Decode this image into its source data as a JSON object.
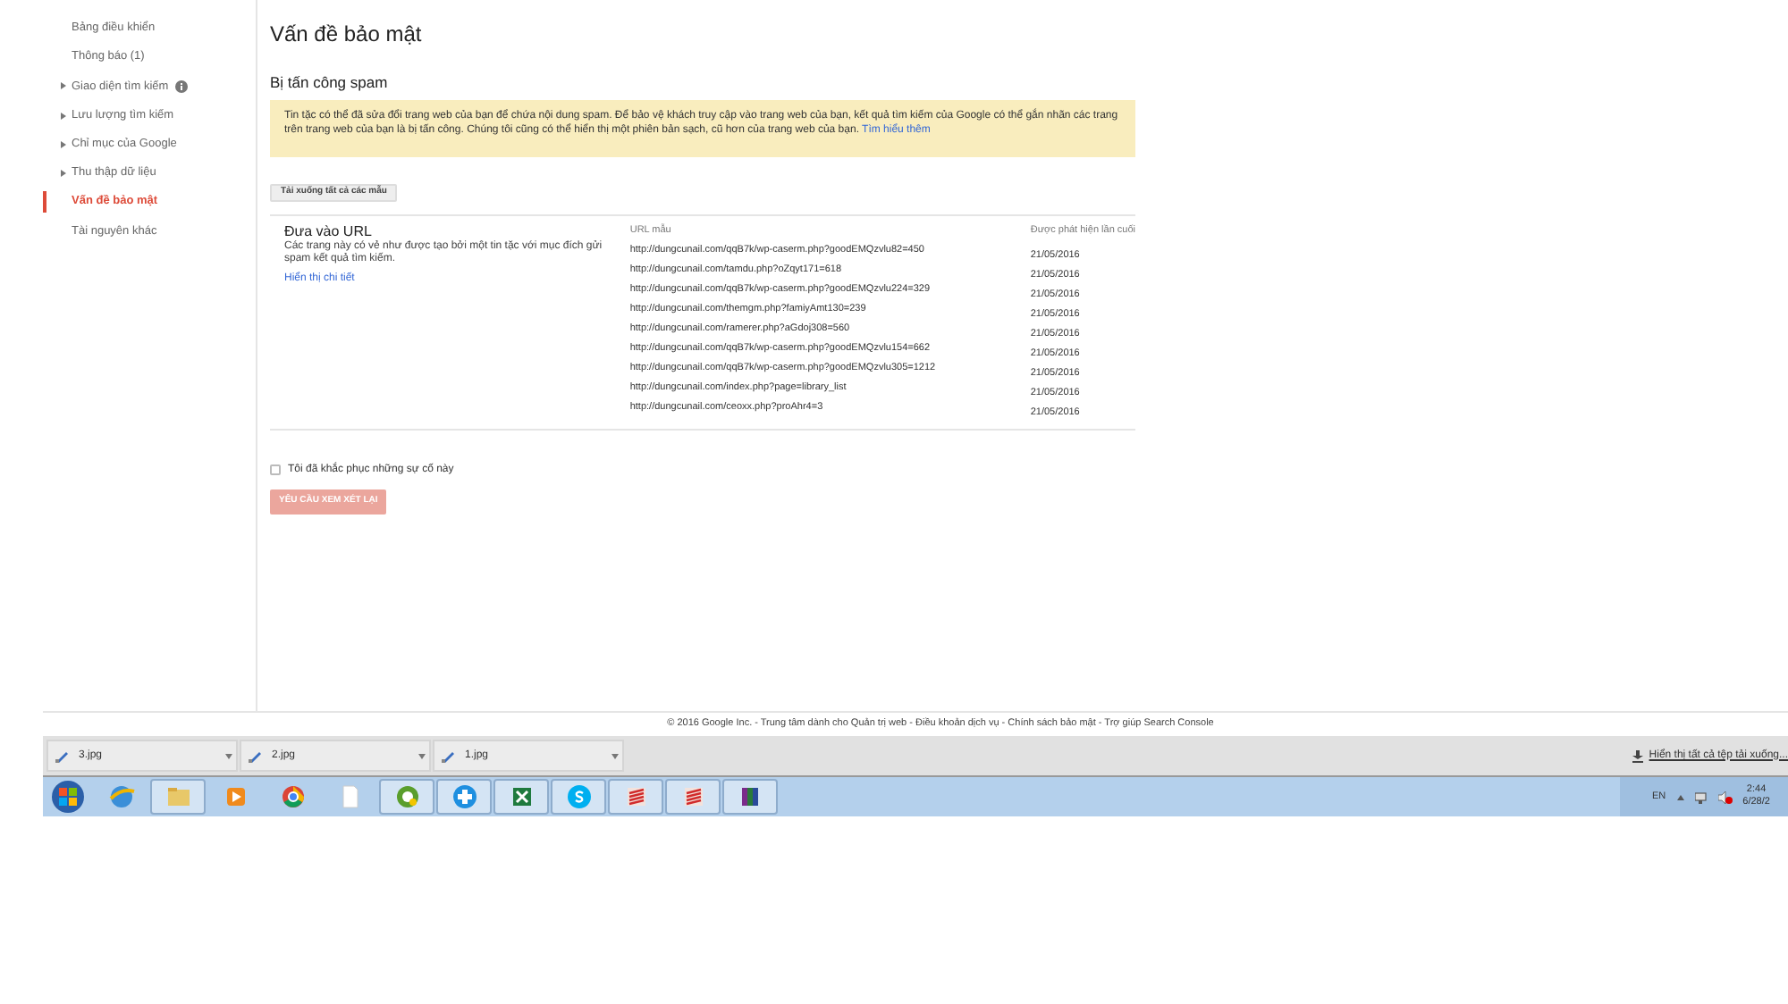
{
  "sidebar": {
    "items": [
      {
        "label": "Bảng điều khiển",
        "expandable": false,
        "selected": false,
        "info": false
      },
      {
        "label": "Thông báo (1)",
        "expandable": false,
        "selected": false,
        "info": false
      },
      {
        "label": "Giao diện tìm kiếm",
        "expandable": true,
        "selected": false,
        "info": true
      },
      {
        "label": "Lưu lượng tìm kiếm",
        "expandable": true,
        "selected": false,
        "info": false
      },
      {
        "label": "Chỉ mục của Google",
        "expandable": true,
        "selected": false,
        "info": false
      },
      {
        "label": "Thu thập dữ liệu",
        "expandable": true,
        "selected": false,
        "info": false
      },
      {
        "label": "Vấn đề bảo mật",
        "expandable": false,
        "selected": true,
        "info": false
      },
      {
        "label": "Tài nguyên khác",
        "expandable": false,
        "selected": false,
        "info": false
      }
    ]
  },
  "page_title": "Vấn đề bảo mật",
  "section_title": "Bị tấn công spam",
  "alert": {
    "text": "Tin tặc có thể đã sửa đổi trang web của bạn để chứa nội dung spam. Để bảo vệ khách truy cập vào trang web của bạn, kết quả tìm kiếm của Google có thể gắn nhãn các trang trên trang web của bạn là bị tấn công. Chúng tôi cũng có thể hiển thị một phiên bản sạch, cũ hơn của trang web của bạn.",
    "link": "Tìm hiểu thêm"
  },
  "download_button": "Tải xuống tất cả các mẫu",
  "issue": {
    "title": "Đưa vào URL",
    "description": "Các trang này có vẻ như được tạo bởi một tin tặc với mục đích gửi spam kết quả tìm kiếm.",
    "details_link": "Hiển thị chi tiết"
  },
  "table": {
    "columns": [
      "URL mẫu",
      "Được phát hiện lần cuối"
    ],
    "rows": [
      [
        "http://dungcunail.com/qqB7k/wp-caserm.php?goodEMQzvlu82=450",
        "21/05/2016"
      ],
      [
        "http://dungcunail.com/tamdu.php?oZqyt171=618",
        "21/05/2016"
      ],
      [
        "http://dungcunail.com/qqB7k/wp-caserm.php?goodEMQzvlu224=329",
        "21/05/2016"
      ],
      [
        "http://dungcunail.com/themgm.php?famiyAmt130=239",
        "21/05/2016"
      ],
      [
        "http://dungcunail.com/ramerer.php?aGdoj308=560",
        "21/05/2016"
      ],
      [
        "http://dungcunail.com/qqB7k/wp-caserm.php?goodEMQzvlu154=662",
        "21/05/2016"
      ],
      [
        "http://dungcunail.com/qqB7k/wp-caserm.php?goodEMQzvlu305=1212",
        "21/05/2016"
      ],
      [
        "http://dungcunail.com/index.php?page=library_list",
        "21/05/2016"
      ],
      [
        "http://dungcunail.com/ceoxx.php?proAhr4=3",
        "21/05/2016"
      ]
    ]
  },
  "fixed_checkbox": {
    "label": "Tôi đã khắc phục những sự cố này",
    "checked": false
  },
  "review_button": {
    "label": "YÊU CẦU XEM XÉT LẠI",
    "disabled": true
  },
  "footer": "© 2016 Google Inc. - Trung tâm dành cho Quản trị web - Điều khoản dịch vụ - Chính sách bảo mật - Trợ giúp Search Console",
  "downloads": {
    "files": [
      "3.jpg",
      "2.jpg",
      "1.jpg"
    ],
    "show_all": "Hiển thị tất cả tệp tải xuống..."
  },
  "tray": {
    "language": "EN",
    "time": "2:44",
    "date": "6/28/2"
  }
}
